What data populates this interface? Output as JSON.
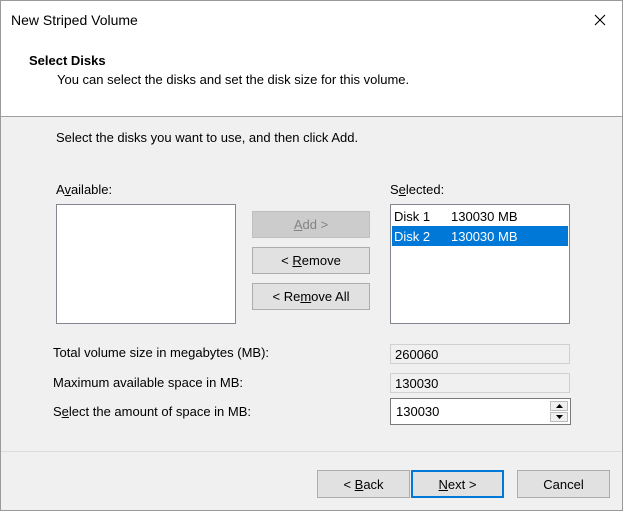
{
  "window": {
    "title": "New Striped Volume",
    "close_icon": "close-icon"
  },
  "header": {
    "title": "Select Disks",
    "subtitle": "You can select the disks and set the disk size for this volume."
  },
  "instruction": "Select the disks you want to use, and then click Add.",
  "available": {
    "label_accel": "v",
    "label_pre": "A",
    "label_post": "ailable:",
    "items": []
  },
  "selected": {
    "label_pre": "S",
    "label_accel": "e",
    "label_post": "lected:",
    "items": [
      {
        "disk": "Disk 1",
        "size": "130030 MB",
        "selected": false
      },
      {
        "disk": "Disk 2",
        "size": "130030 MB",
        "selected": true
      }
    ]
  },
  "buttons": {
    "add": {
      "accel": "A",
      "rest": "dd >",
      "enabled": false
    },
    "remove": {
      "pre": "< ",
      "accel": "R",
      "rest": "emove"
    },
    "remove_all": {
      "pre": "< Re",
      "accel": "m",
      "rest": "ove All"
    }
  },
  "fields": {
    "total_label": "Total volume size in megabytes (MB):",
    "total_value": "260060",
    "max_label": "Maximum available space in MB:",
    "max_value": "130030",
    "amount_label_pre": "S",
    "amount_label_accel": "e",
    "amount_label_post": "lect the amount of space in MB:",
    "amount_value": "130030"
  },
  "footer": {
    "back": {
      "pre": "< ",
      "accel": "B",
      "rest": "ack"
    },
    "next": {
      "accel": "N",
      "rest": "ext >"
    },
    "cancel": "Cancel"
  },
  "colors": {
    "selection": "#0078d7",
    "dialog_bg": "#f0f0f0"
  }
}
